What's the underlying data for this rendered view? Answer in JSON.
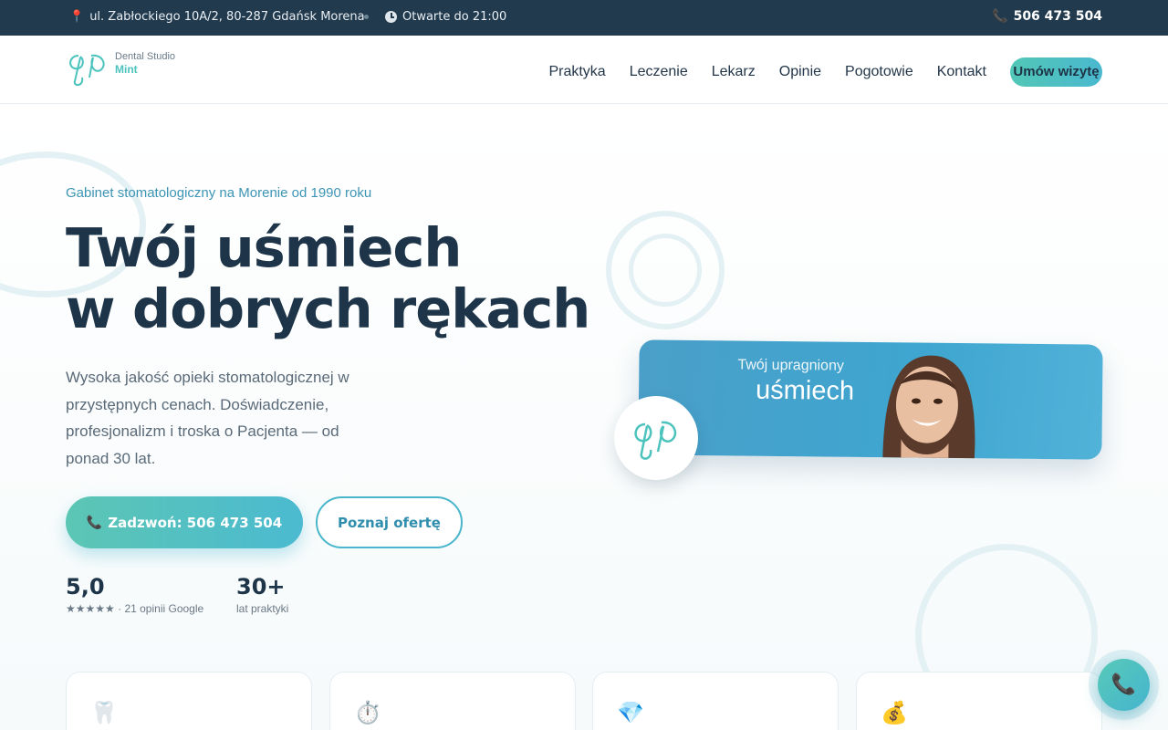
{
  "topbar": {
    "address": "ul. Zabłockiego 10A/2, 80-287 Gdańsk Morena",
    "hours": "Otwarte do 21:00",
    "phone": "506 473 504"
  },
  "logo": {
    "line1": "Dental Studio",
    "line2": "Mint"
  },
  "nav": {
    "items": [
      "Praktyka",
      "Leczenie",
      "Lekarz",
      "Opinie",
      "Pogotowie",
      "Kontakt"
    ],
    "cta": "Umów wizytę"
  },
  "hero": {
    "eyebrow": "Gabinet stomatologiczny na Morenie od 1990 roku",
    "headline_line1": "Twój uśmiech",
    "headline_line2": "w dobrych rękach",
    "lead": "Wysoka jakość opieki stomatologicznej w przystępnych cenach. Doświadczenie, profesjonalizm i troska o Pacjenta — od ponad 30 lat.",
    "call_button": "Zadzwoń: 506 473 504",
    "offer_button": "Poznaj ofertę",
    "stats": [
      {
        "value": "5,0",
        "label": "★★★★★ · 21 opinii Google"
      },
      {
        "value": "30+",
        "label": "lat praktyki"
      }
    ]
  },
  "banner": {
    "line1": "Twój upragniony",
    "line2": "uśmiech"
  },
  "cards": [
    {
      "icon": "tooth-icon",
      "glyph": "🦷"
    },
    {
      "icon": "stopwatch-icon",
      "glyph": "⏱️"
    },
    {
      "icon": "diamond-icon",
      "glyph": "💎"
    },
    {
      "icon": "money-bag-icon",
      "glyph": "💰"
    }
  ],
  "colors": {
    "topbar": "#213a4d",
    "accent_teal": "#52c7b6",
    "accent_blue": "#4ab8cf",
    "heading": "#1e3549",
    "phone_icon": "#e4567c"
  }
}
